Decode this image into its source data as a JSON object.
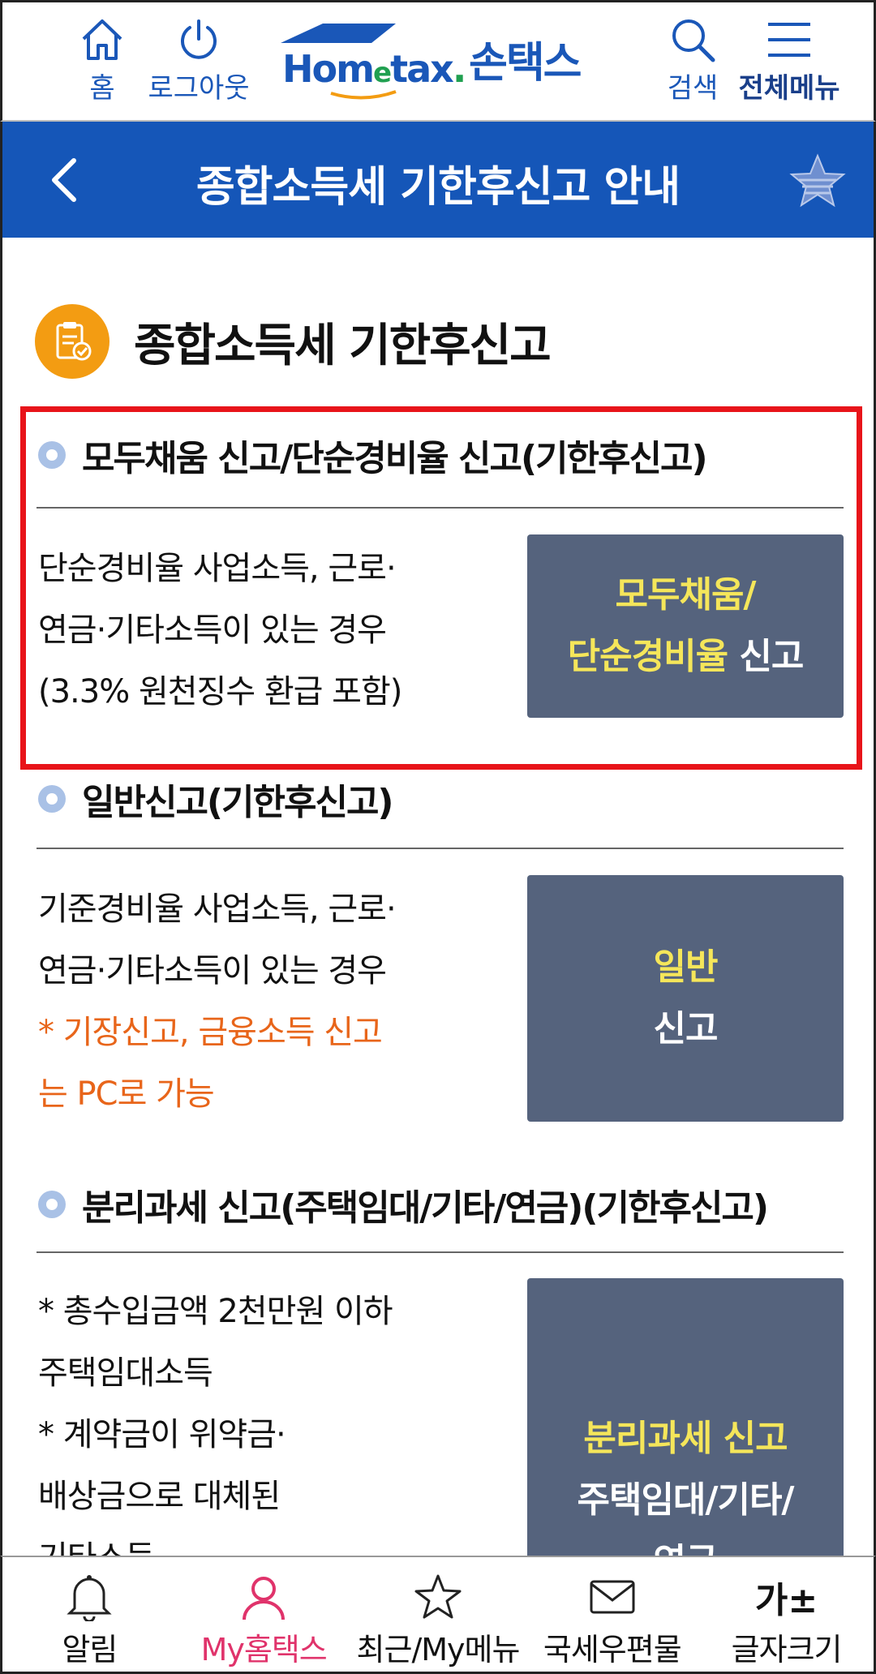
{
  "header": {
    "home_label": "홈",
    "logout_label": "로그아웃",
    "logo_text": "Hometax.",
    "logo_brand": "손택스",
    "search_label": "검색",
    "menu_label": "전체메뉴"
  },
  "titlebar": {
    "title": "종합소득세 기한후신고 안내"
  },
  "section": {
    "title": "종합소득세 기한후신고"
  },
  "blocks": [
    {
      "title": "모두채움 신고/단순경비율 신고(기한후신고)",
      "desc_lines": [
        "단순경비율 사업소득, 근로·",
        "연금·기타소득이 있는 경우",
        "(3.3% 원천징수 환급 포함)"
      ],
      "button_line1": "모두채움/",
      "button_line2_yellow": "단순경비율",
      "button_line2_white": " 신고"
    },
    {
      "title": "일반신고(기한후신고)",
      "desc_lines": [
        "기준경비율 사업소득, 근로·",
        "연금·기타소득이 있는 경우"
      ],
      "note_lines": [
        "* 기장신고, 금융소득 신고",
        "는 PC로 가능"
      ],
      "button_line1": "일반",
      "button_line2": "신고"
    },
    {
      "title": "분리과세 신고(주택임대/기타/연금)(기한후신고)",
      "desc_lines": [
        "* 총수입금액 2천만원 이하",
        "주택임대소득",
        "* 계약금이 위약금·",
        "배상금으로 대체된",
        "기타소득"
      ],
      "button_line1": "분리과세 신고",
      "button_line2": "주택임대/기타/",
      "button_line3": "연금"
    }
  ],
  "bottom_nav": {
    "items": [
      {
        "label": "알림",
        "icon": "bell-icon"
      },
      {
        "label": "My홈택스",
        "icon": "person-icon",
        "active": true
      },
      {
        "label": "최근/My메뉴",
        "icon": "star-icon"
      },
      {
        "label": "국세우편물",
        "icon": "mail-icon"
      },
      {
        "label": "글자크기",
        "icon": "font-size-icon",
        "glyph": "가±"
      }
    ]
  },
  "colors": {
    "brand_blue": "#1556b8",
    "button_bg": "#55637d",
    "button_highlight": "#f5e65a",
    "note_orange": "#e8651a",
    "highlight_box": "#e8141a",
    "active_nav": "#e0336b"
  }
}
